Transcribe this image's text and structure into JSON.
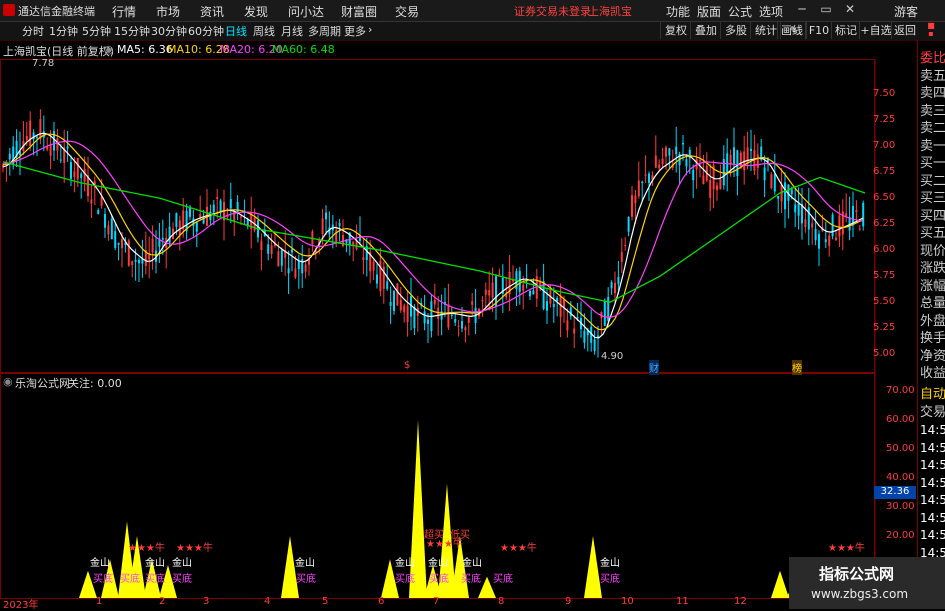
{
  "app": {
    "name": "通达信金融终端"
  },
  "menu": {
    "items": [
      "行情",
      "市场",
      "资讯",
      "发现",
      "问小达",
      "财富圈",
      "交易"
    ],
    "login_warning": "证券交易未登录",
    "stock_name": "上海凯宝",
    "right_items": [
      "功能",
      "版面",
      "公式",
      "选项"
    ],
    "guest": "游客"
  },
  "toolbar": {
    "periods": [
      "分时",
      "1分钟",
      "5分钟",
      "15分钟",
      "30分钟",
      "60分钟",
      "日线",
      "周线",
      "月线",
      "多周期",
      "更多"
    ],
    "active_period": "日线",
    "right_buttons": [
      "复权",
      "叠加",
      "多股",
      "统计",
      "画线",
      "F10",
      "标记",
      "+自选",
      "返回"
    ]
  },
  "price_chart": {
    "title": "上海凯宝(日线 前复权)",
    "ma": [
      {
        "label": "MA5: 6.36",
        "color": "#ffffff"
      },
      {
        "label": "MA10: 6.28",
        "color": "#ffd400"
      },
      {
        "label": "MA20: 6.20",
        "color": "#ff40ff"
      },
      {
        "label": "MA60: 6.48",
        "color": "#00e000"
      }
    ],
    "high_label": "7.78",
    "low_label": "4.90",
    "y_ticks": [
      "7.50",
      "7.25",
      "7.00",
      "6.75",
      "6.50",
      "6.25",
      "6.00",
      "5.75",
      "5.50",
      "5.25",
      "5.00"
    ],
    "markers": [
      "$",
      "财",
      "榜"
    ]
  },
  "indicator_chart": {
    "title": "乐淘公式网",
    "focus_label": "关注: 0.00",
    "y_ticks": [
      "70.00",
      "60.00",
      "50.00",
      "40.00",
      "30.00",
      "20.00",
      "10.00"
    ],
    "current_value": "32.36",
    "labels": {
      "jinshan": "金山",
      "maidi": "买底",
      "niu": "★★★牛",
      "chaomai": "超买",
      "fanmai": "低买"
    }
  },
  "x_axis": {
    "year": "2023年",
    "months": [
      "1",
      "2",
      "3",
      "4",
      "5",
      "6",
      "7",
      "8",
      "9",
      "10",
      "11",
      "12"
    ]
  },
  "side_panel": {
    "items": [
      "委比",
      "卖五",
      "卖四",
      "卖三",
      "卖二",
      "卖一",
      "买一",
      "买二",
      "买三",
      "买四",
      "买五",
      "现价",
      "涨跌",
      "涨幅",
      "总量",
      "外盘",
      "换手",
      "净资",
      "收益"
    ],
    "tabs": [
      "自动",
      "交易"
    ],
    "times": [
      "14:5",
      "14:5",
      "14:5",
      "14:5",
      "14:5",
      "14:5",
      "14:5",
      "14:5",
      "14:5"
    ]
  },
  "watermark": {
    "title": "指标公式网",
    "url": "www.zbgs3.com"
  },
  "colors": {
    "up": "#ff3b3b",
    "down": "#00d8ff",
    "border": "#7a0000",
    "bar": "#ffff00",
    "ma5": "#ffffff",
    "ma10": "#ffd400",
    "ma20": "#ff40ff",
    "ma60": "#00e000"
  }
}
